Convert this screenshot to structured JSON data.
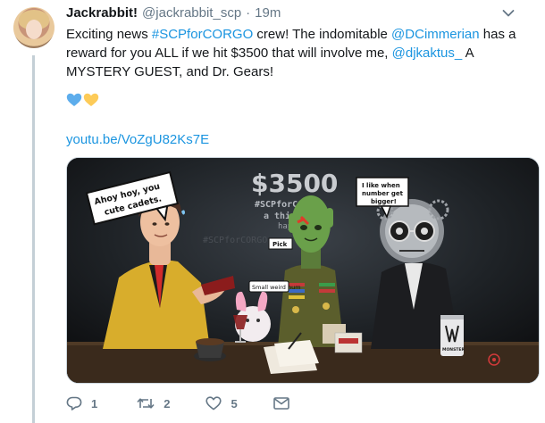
{
  "tweet": {
    "display_name": "Jackrabbit!",
    "handle": "@jackrabbit_scp",
    "separator": "·",
    "time": "19m",
    "text_parts": {
      "p1": "Exciting news ",
      "hashtag": "#SCPforCORGO",
      "p2": " crew! The indomitable ",
      "mention1": "@DCimmerian",
      "p3": " has a reward for you ALL if we hit $3500 that will involve me, ",
      "mention2": "@djkaktus_",
      "p4": " A MYSTERY GUEST, and Dr. Gears!"
    },
    "emoji": [
      "blue-heart",
      "yellow-heart"
    ],
    "link": "youtu.be/VoZgU82Ks7E"
  },
  "media": {
    "headline": "$3500",
    "tag": "#SCPforCORGO",
    "subline1": "a thing will",
    "subline2": "happen",
    "tag_faint": "#SCPforCORGO",
    "bubble_left": "Ahoy hoy, you cute cadets.",
    "bubble_right": "I like when number get bigger!",
    "bubble_small": "Small weird hum",
    "bubble_pick": "Pick",
    "can_label": "MONSTER"
  },
  "actions": {
    "reply_count": "1",
    "retweet_count": "2",
    "like_count": "5"
  },
  "colors": {
    "link": "#1b95e0",
    "muted": "#657786",
    "text": "#14171a",
    "thread": "#c4cfd6"
  }
}
